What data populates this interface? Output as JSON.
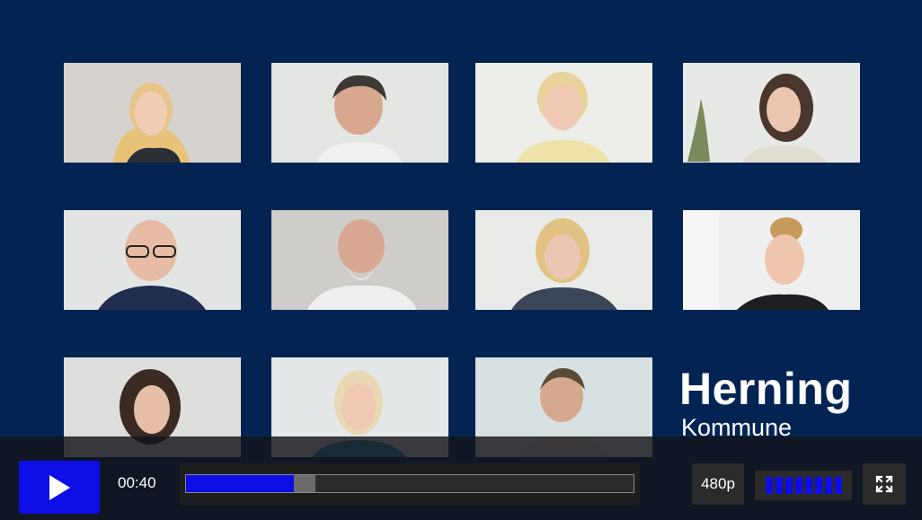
{
  "video": {
    "tiles_row1": [
      "participant-1",
      "participant-2",
      "participant-3",
      "participant-4"
    ],
    "tiles_row2": [
      "participant-5",
      "participant-6",
      "participant-7",
      "participant-8"
    ],
    "tiles_row3": [
      "participant-9",
      "participant-10",
      "participant-11"
    ],
    "logo": {
      "line1": "Herning",
      "line2": "Kommune"
    }
  },
  "player": {
    "current_time": "00:40",
    "progress_played_fraction": 0.24,
    "progress_buffered_fraction": 0.29,
    "quality_label": "480p",
    "volume_bars": 8,
    "volume_level": 1.0,
    "play_icon": "play-icon",
    "fullscreen_icon": "fullscreen-icon",
    "colors": {
      "accent": "#0d0de6",
      "background": "#032452"
    }
  }
}
